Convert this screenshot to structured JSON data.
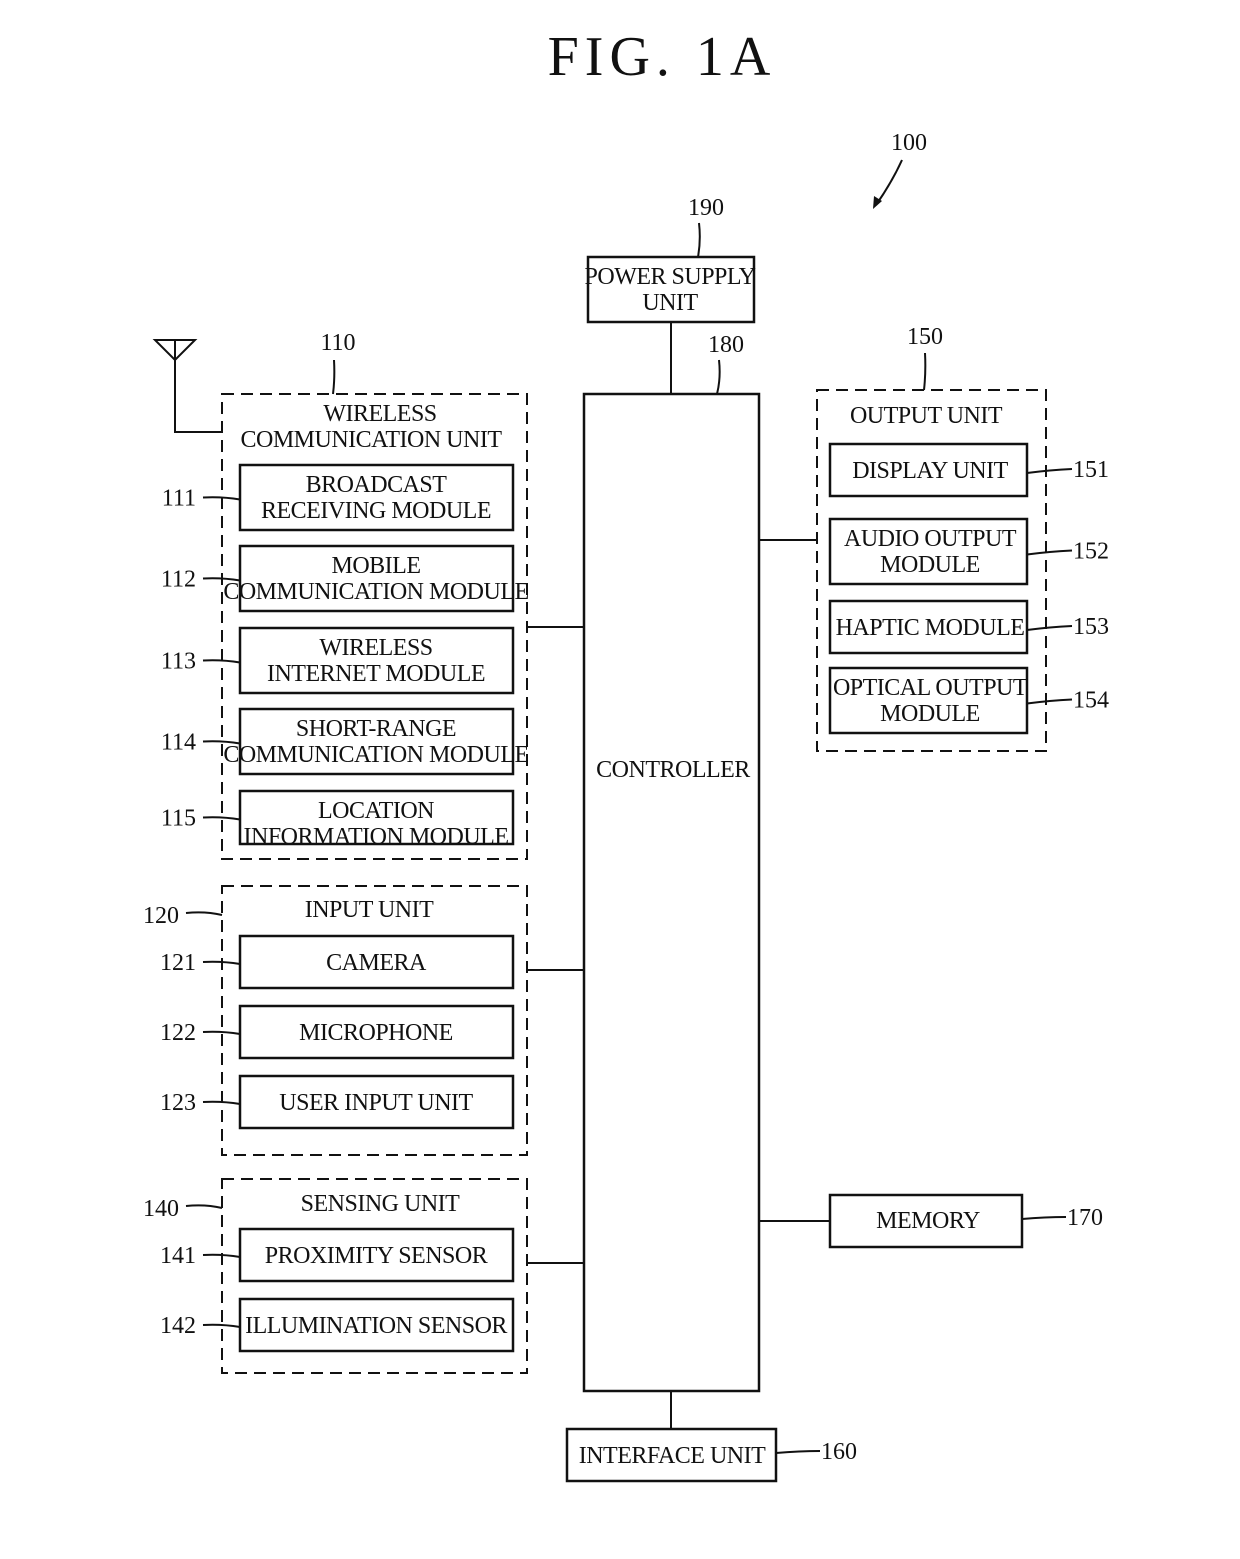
{
  "figure": {
    "title": "FIG. 1A",
    "device_ref": "100"
  },
  "power_supply": {
    "ref": "190",
    "lines": [
      "POWER SUPPLY",
      "UNIT"
    ]
  },
  "controller": {
    "ref": "180",
    "label": "CONTROLLER"
  },
  "wireless_unit": {
    "ref": "110",
    "lines": [
      "WIRELESS",
      "COMMUNICATION UNIT"
    ],
    "modules": [
      {
        "ref": "111",
        "lines": [
          "BROADCAST",
          "RECEIVING MODULE"
        ]
      },
      {
        "ref": "112",
        "lines": [
          "MOBILE",
          "COMMUNICATION MODULE"
        ]
      },
      {
        "ref": "113",
        "lines": [
          "WIRELESS",
          "INTERNET MODULE"
        ]
      },
      {
        "ref": "114",
        "lines": [
          "SHORT-RANGE",
          "COMMUNICATION MODULE"
        ]
      },
      {
        "ref": "115",
        "lines": [
          "LOCATION",
          "INFORMATION MODULE"
        ]
      }
    ]
  },
  "input_unit": {
    "ref": "120",
    "label": "INPUT UNIT",
    "modules": [
      {
        "ref": "121",
        "label": "CAMERA"
      },
      {
        "ref": "122",
        "label": "MICROPHONE"
      },
      {
        "ref": "123",
        "label": "USER INPUT UNIT"
      }
    ]
  },
  "sensing_unit": {
    "ref": "140",
    "label": "SENSING UNIT",
    "modules": [
      {
        "ref": "141",
        "label": "PROXIMITY SENSOR"
      },
      {
        "ref": "142",
        "label": "ILLUMINATION SENSOR"
      }
    ]
  },
  "output_unit": {
    "ref": "150",
    "label": "OUTPUT UNIT",
    "modules": [
      {
        "ref": "151",
        "lines": [
          "DISPLAY UNIT"
        ]
      },
      {
        "ref": "152",
        "lines": [
          "AUDIO OUTPUT",
          "MODULE"
        ]
      },
      {
        "ref": "153",
        "lines": [
          "HAPTIC MODULE"
        ]
      },
      {
        "ref": "154",
        "lines": [
          "OPTICAL OUTPUT",
          "MODULE"
        ]
      }
    ]
  },
  "memory": {
    "ref": "170",
    "label": "MEMORY"
  },
  "interface_unit": {
    "ref": "160",
    "label": "INTERFACE UNIT"
  }
}
